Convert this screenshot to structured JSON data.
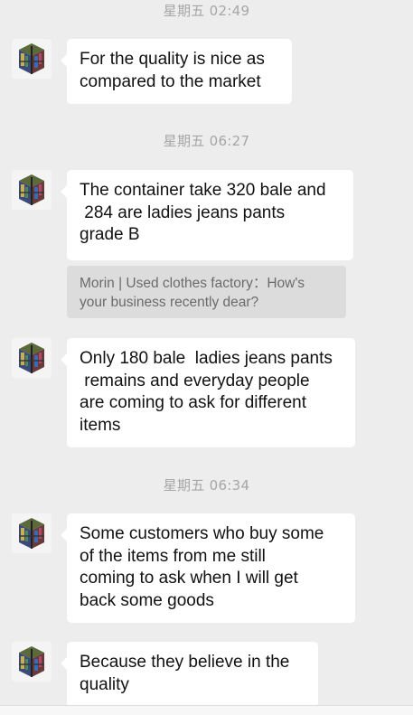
{
  "colors": {
    "background": "#ededed",
    "bubble": "#ffffff",
    "quote_bg": "#dcdcdc",
    "timestamp_text": "#a6a6a6"
  },
  "chat": {
    "timestamps": [
      "星期五 02:49",
      "星期五 06:27",
      "星期五 06:34"
    ],
    "messages": [
      "For the quality is nice as\ncompared to the market",
      "The container take 320 bale and\n 284 are ladies jeans pants\ngrade B",
      "Only 180 bale  ladies jeans pants\n remains and everyday people\nare coming to ask for different\nitems",
      "Some customers who buy some\nof the items from me still\ncoming to ask when I will get\nback some goods",
      "Because they believe in the\nquality"
    ],
    "quote": "Morin | Used clothes factory：How's your business recently dear?",
    "avatar_icon": "clothes-bale-avatar-icon"
  }
}
